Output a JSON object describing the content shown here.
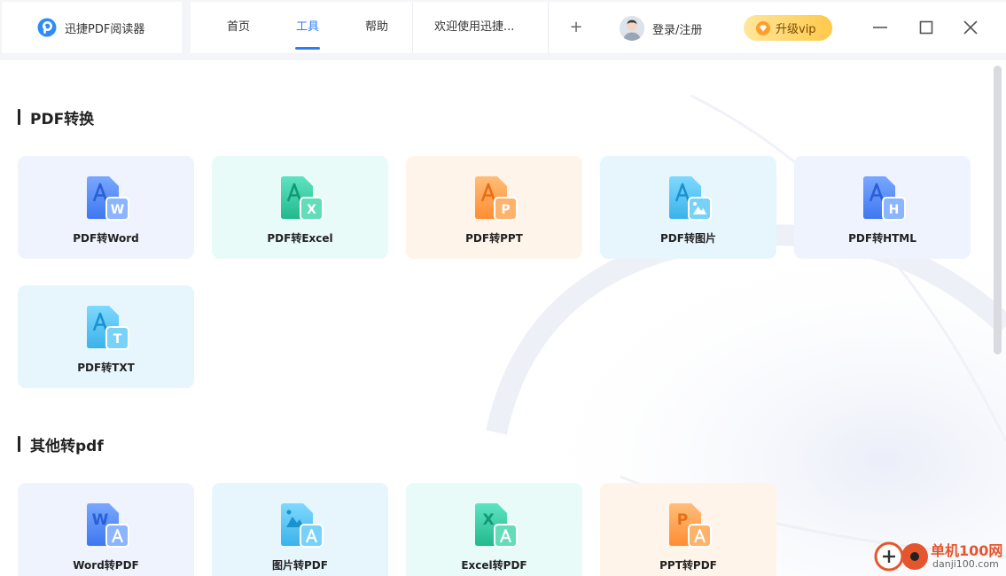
{
  "app": {
    "title": "迅捷PDF阅读器"
  },
  "nav": {
    "tabs": [
      {
        "label": "首页"
      },
      {
        "label": "工具",
        "active": true
      },
      {
        "label": "帮助"
      }
    ],
    "doc_tab": "欢迎使用迅捷...",
    "new_tab_symbol": "+",
    "login_label": "登录/注册",
    "vip_label": "升级vip"
  },
  "colors": {
    "accent": "#2f7cf6",
    "vip": "#ffc94a"
  },
  "sections": [
    {
      "title": "PDF转换",
      "items": [
        {
          "label": "PDF转Word",
          "badge": "W",
          "icon": "pdf-to-word-icon"
        },
        {
          "label": "PDF转Excel",
          "badge": "X",
          "icon": "pdf-to-excel-icon"
        },
        {
          "label": "PDF转PPT",
          "badge": "P",
          "icon": "pdf-to-ppt-icon"
        },
        {
          "label": "PDF转图片",
          "badge": "",
          "icon": "pdf-to-image-icon"
        },
        {
          "label": "PDF转HTML",
          "badge": "H",
          "icon": "pdf-to-html-icon"
        },
        {
          "label": "PDF转TXT",
          "badge": "T",
          "icon": "pdf-to-txt-icon"
        }
      ]
    },
    {
      "title": "其他转pdf",
      "items": [
        {
          "label": "Word转PDF",
          "badge": "W",
          "icon": "word-to-pdf-icon"
        },
        {
          "label": "图片转PDF",
          "badge": "",
          "icon": "image-to-pdf-icon"
        },
        {
          "label": "Excel转PDF",
          "badge": "X",
          "icon": "excel-to-pdf-icon"
        },
        {
          "label": "PPT转PDF",
          "badge": "P",
          "icon": "ppt-to-pdf-icon"
        }
      ]
    }
  ],
  "watermark": {
    "name": "单机100网",
    "url": "danji100.com"
  }
}
